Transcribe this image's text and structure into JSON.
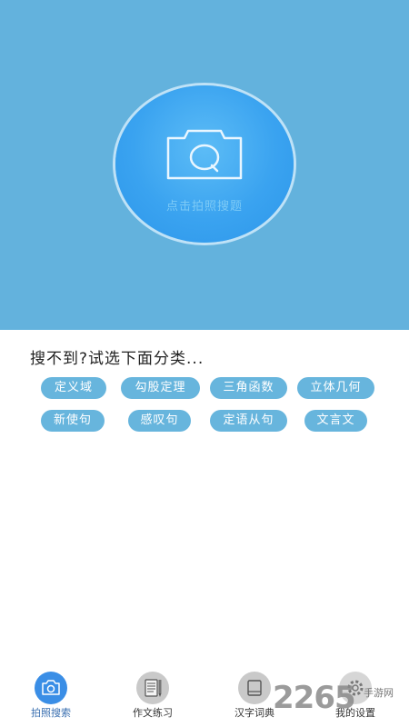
{
  "hero": {
    "camera_label": "点击拍照搜题"
  },
  "prompt": "搜不到?试选下面分类...",
  "categories": [
    "定义域",
    "勾股定理",
    "三角函数",
    "立体几何",
    "新使句",
    "感叹句",
    "定语从句",
    "文言文"
  ],
  "tabs": [
    {
      "label": "拍照搜索",
      "icon": "camera-icon",
      "active": true
    },
    {
      "label": "作文练习",
      "icon": "notebook-pencil-icon",
      "active": false
    },
    {
      "label": "汉字词典",
      "icon": "book-icon",
      "active": false
    },
    {
      "label": "我的设置",
      "icon": "gear-icon",
      "active": false
    }
  ],
  "watermark": {
    "big": "2265",
    "small": "手游网"
  },
  "colors": {
    "hero_bg": "#63b2dd",
    "circle": "#3aa3f0",
    "chip": "#67b5dd",
    "active_tab": "#3a8ee6"
  }
}
